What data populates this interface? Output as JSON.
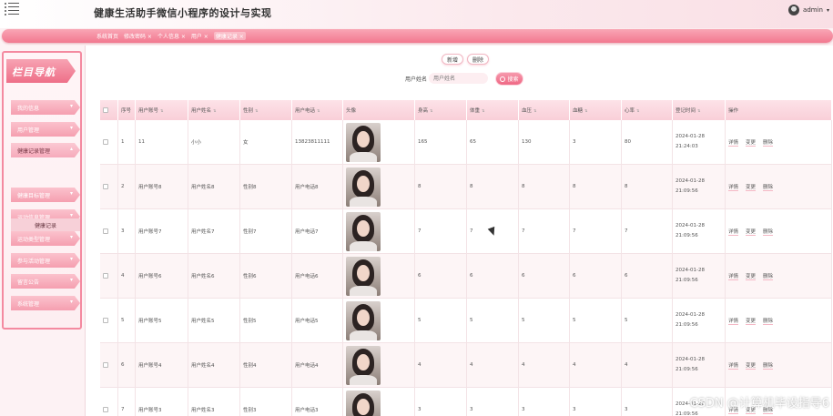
{
  "header": {
    "title": "健康生活助手微信小程序的设计与实现",
    "user": "admin"
  },
  "tabs": [
    "系统首页",
    "修改密码 ×",
    "个人信息 ×",
    "用户 ×",
    "健康记录 ×"
  ],
  "sidebar": {
    "title": "栏目导航",
    "items": [
      "我的信息",
      "用户管理",
      "健康记录管理",
      "健康目标管理",
      "运动信息管理",
      "运动类型管理",
      "参与活动管理",
      "留言公告",
      "系统管理"
    ],
    "sub_items": [
      "健康记录"
    ]
  },
  "toolbar": {
    "add_label": "新增",
    "delete_label": "删除",
    "search_label": "用户姓名",
    "search_placeholder": "用户姓名",
    "search_button": "搜索"
  },
  "table": {
    "columns": [
      "序号",
      "用户账号",
      "用户姓名",
      "性别",
      "用户电话",
      "头像",
      "身高",
      "体重",
      "血压",
      "血糖",
      "心率",
      "登记时间",
      "操作"
    ],
    "actions": [
      "详情",
      "变更",
      "删除"
    ],
    "rows": [
      {
        "no": "1",
        "account": "11",
        "name": "小小",
        "gender": "女",
        "phone": "13823811111",
        "height": "165",
        "weight": "65",
        "bp": "130",
        "sugar": "3",
        "hr": "80",
        "time": "2024-01-28 21:24:03"
      },
      {
        "no": "2",
        "account": "用户账号8",
        "name": "用户姓名8",
        "gender": "性别8",
        "phone": "用户电话8",
        "height": "8",
        "weight": "8",
        "bp": "8",
        "sugar": "8",
        "hr": "8",
        "time": "2024-01-28 21:09:56"
      },
      {
        "no": "3",
        "account": "用户账号7",
        "name": "用户姓名7",
        "gender": "性别7",
        "phone": "用户电话7",
        "height": "7",
        "weight": "7",
        "bp": "7",
        "sugar": "7",
        "hr": "7",
        "time": "2024-01-28 21:09:56"
      },
      {
        "no": "4",
        "account": "用户账号6",
        "name": "用户姓名6",
        "gender": "性别6",
        "phone": "用户电话6",
        "height": "6",
        "weight": "6",
        "bp": "6",
        "sugar": "6",
        "hr": "6",
        "time": "2024-01-28 21:09:56"
      },
      {
        "no": "5",
        "account": "用户账号5",
        "name": "用户姓名5",
        "gender": "性别5",
        "phone": "用户电话5",
        "height": "5",
        "weight": "5",
        "bp": "5",
        "sugar": "5",
        "hr": "5",
        "time": "2024-01-28 21:09:56"
      },
      {
        "no": "6",
        "account": "用户账号4",
        "name": "用户姓名4",
        "gender": "性别4",
        "phone": "用户电话4",
        "height": "4",
        "weight": "4",
        "bp": "4",
        "sugar": "4",
        "hr": "4",
        "time": "2024-01-28 21:09:56"
      },
      {
        "no": "7",
        "account": "用户账号3",
        "name": "用户姓名3",
        "gender": "性别3",
        "phone": "用户电话3",
        "height": "3",
        "weight": "3",
        "bp": "3",
        "sugar": "3",
        "hr": "3",
        "time": "2024-01-28 21:09:56"
      }
    ]
  },
  "watermark": "CSDN @计算机毕设指导6",
  "colors": {
    "accent": "#f2788f",
    "accent_light": "#fde2e8",
    "background": "#fdf2f4"
  }
}
